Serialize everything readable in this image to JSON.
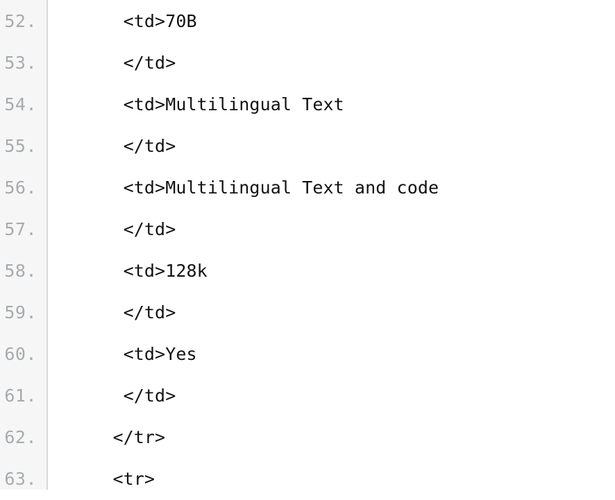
{
  "editor": {
    "language": "html",
    "gutter_background": "#f6f6f6",
    "gutter_border_color": "#d5d7d9",
    "line_number_color": "#a8abae",
    "text_color": "#121212",
    "background": "#ffffff",
    "first_visible_line": 52,
    "last_visible_line": 63,
    "line_number_suffix": "."
  },
  "lines": [
    {
      "number": "52.",
      "text": "    <td>70B"
    },
    {
      "number": "53.",
      "text": "    </td>"
    },
    {
      "number": "54.",
      "text": "    <td>Multilingual Text"
    },
    {
      "number": "55.",
      "text": "    </td>"
    },
    {
      "number": "56.",
      "text": "    <td>Multilingual Text and code"
    },
    {
      "number": "57.",
      "text": "    </td>"
    },
    {
      "number": "58.",
      "text": "    <td>128k"
    },
    {
      "number": "59.",
      "text": "    </td>"
    },
    {
      "number": "60.",
      "text": "    <td>Yes"
    },
    {
      "number": "61.",
      "text": "    </td>"
    },
    {
      "number": "62.",
      "text": "   </tr>"
    },
    {
      "number": "63.",
      "text": "   <tr>"
    }
  ]
}
